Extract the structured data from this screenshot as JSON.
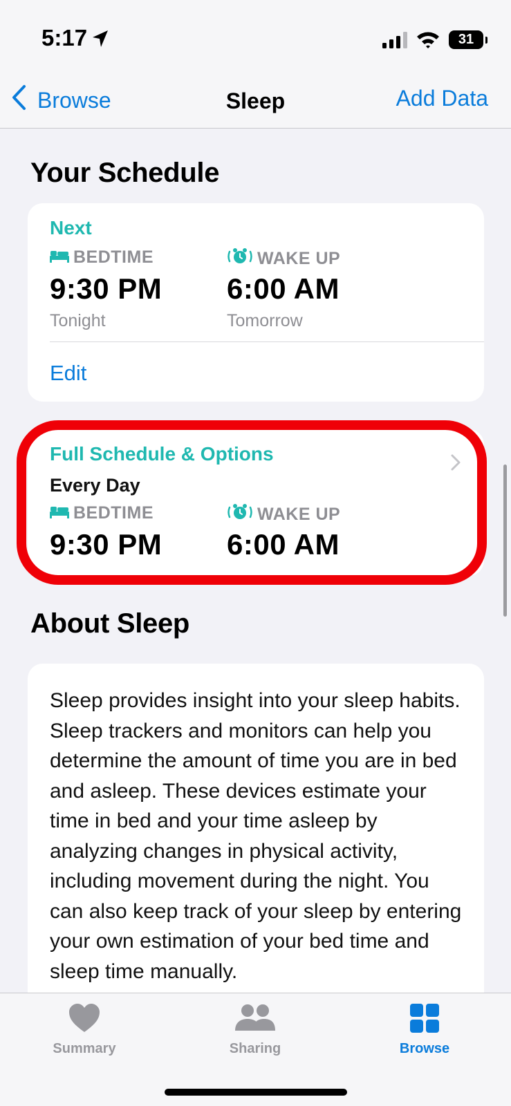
{
  "status_bar": {
    "time": "5:17",
    "battery": "31"
  },
  "nav": {
    "back_label": "Browse",
    "title": "Sleep",
    "action_label": "Add Data"
  },
  "schedule": {
    "section_title": "Your Schedule",
    "next_card": {
      "heading": "Next",
      "bedtime_label": "BEDTIME",
      "bedtime_value": "9:30 PM",
      "bedtime_day": "Tonight",
      "wake_label": "WAKE UP",
      "wake_value": "6:00 AM",
      "wake_day": "Tomorrow",
      "edit_label": "Edit"
    },
    "full_card": {
      "heading": "Full Schedule & Options",
      "days": "Every Day",
      "bedtime_label": "BEDTIME",
      "bedtime_value": "9:30 PM",
      "wake_label": "WAKE UP",
      "wake_value": "6:00 AM"
    }
  },
  "about": {
    "section_title": "About Sleep",
    "body": "Sleep provides insight into your sleep habits. Sleep trackers and monitors can help you determine the amount of time you are in bed and asleep. These devices estimate your time in bed and your time asleep by analyzing changes in physical activity, including movement during the night. You can also keep track of your sleep by entering your own estimation of your bed time and sleep time manually."
  },
  "tab_bar": {
    "tabs": [
      {
        "label": "Summary",
        "icon": "heart-icon",
        "active": false
      },
      {
        "label": "Sharing",
        "icon": "people-icon",
        "active": false
      },
      {
        "label": "Browse",
        "icon": "grid-icon",
        "active": true
      }
    ]
  },
  "colors": {
    "accent_blue": "#0a7cdb",
    "sleep_teal": "#1fb8b0",
    "highlight_red": "#ef0007",
    "background": "#f2f2f7"
  }
}
